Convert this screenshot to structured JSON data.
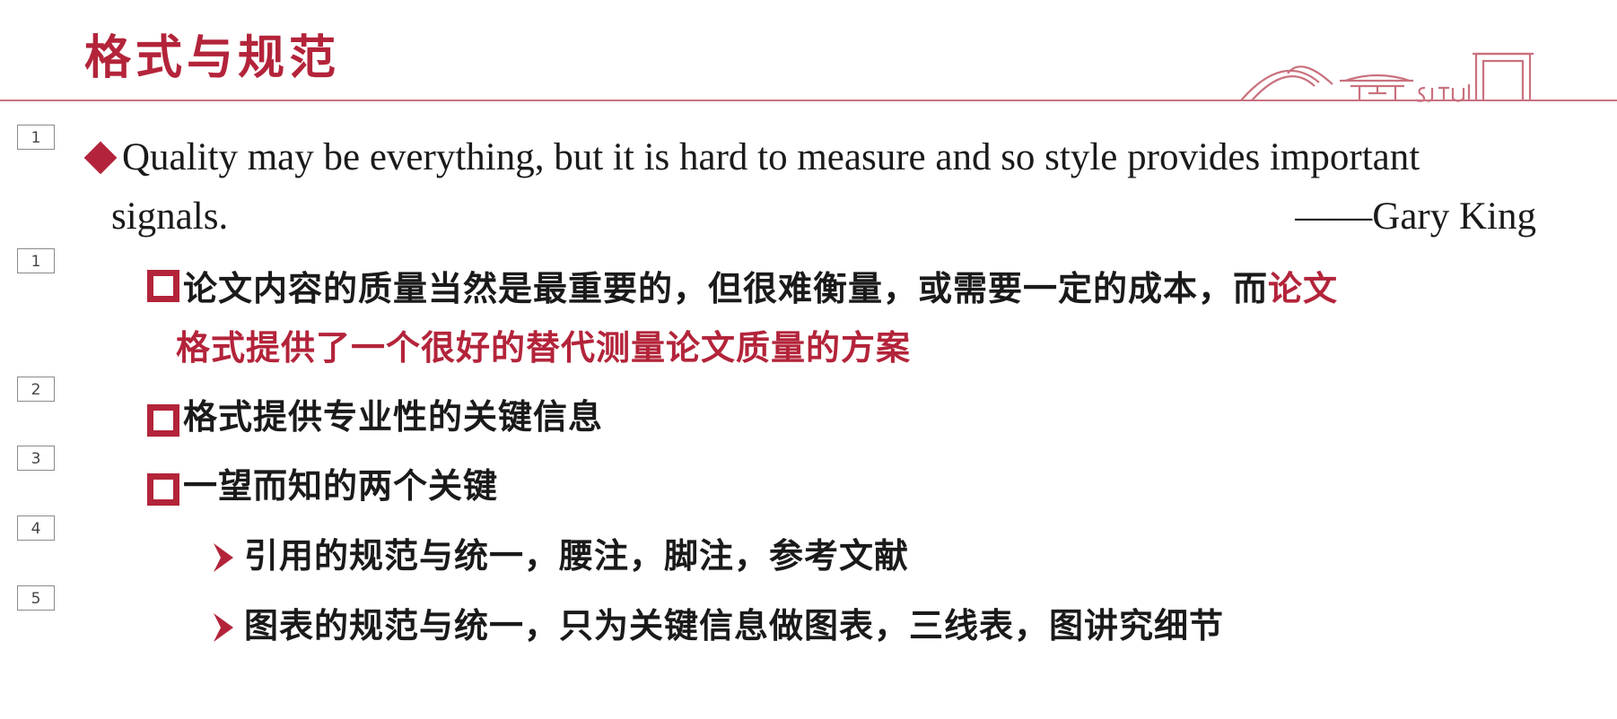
{
  "slide": {
    "title": "格式与规范"
  },
  "anim_tags": [
    "1",
    "1",
    "2",
    "3",
    "4",
    "5"
  ],
  "quote": {
    "line1": "Quality may be everything, but it is hard to measure and so style provides important",
    "line2": "signals.",
    "attribution": "——Gary King"
  },
  "points": {
    "p1_black": "论文内容的质量当然是最重要的，但很难衡量，或需要一定的成本，而",
    "p1_red_a": "论文",
    "p1_red_b": "格式提供了一个很好的替代测量论文质量的方案",
    "p2": "格式提供专业性的关键信息",
    "p3": "一望而知的两个关键",
    "sub1": "引用的规范与统一，腰注，脚注，参考文献",
    "sub2": "图表的规范与统一，只为关键信息做图表，三线表，图讲究细节"
  },
  "colors": {
    "accent": "#b3243a",
    "text": "#1a1a1a",
    "rule": "#c9717e"
  },
  "icons": {
    "level1_bullet": "diamond",
    "level2_bullet": "hollow-square",
    "level3_bullet": "arrowhead",
    "header_decoration": "campus-gate-line-art"
  }
}
